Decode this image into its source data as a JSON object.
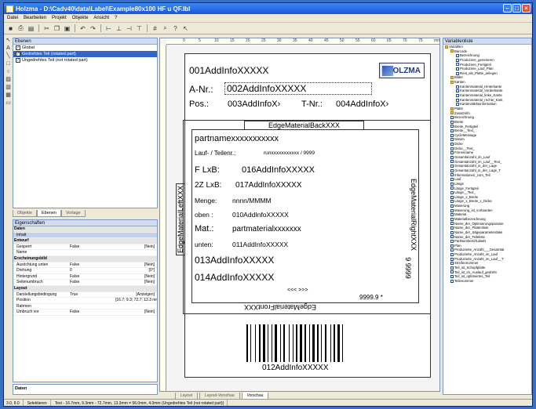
{
  "window": {
    "title": "Holzma - D:\\Cadv40\\data\\Label\\Example80x100 HF u QF.lbl"
  },
  "menu": [
    "Datei",
    "Bearbeiten",
    "Projekt",
    "Objekte",
    "Ansicht",
    "?"
  ],
  "layers_panel": {
    "header": "Ebenen",
    "items": [
      {
        "label": "Global",
        "checked": true
      },
      {
        "label": "Gedrehtes Teil (rotated part)",
        "checked": true,
        "selected": true
      },
      {
        "label": "Ungedrehtes Teil (not rotated part)",
        "checked": true
      }
    ]
  },
  "left_tabs": {
    "items": [
      "Objekte",
      "Ebenen",
      "Vorlage"
    ],
    "active": 1
  },
  "props_panel": {
    "header": "Eigenschaften",
    "rows": [
      {
        "type": "cat",
        "name": "Daten"
      },
      {
        "name": "Inhalt",
        "value": "",
        "unit": ""
      },
      {
        "type": "cat",
        "name": "Entwurf"
      },
      {
        "name": "Gesperrt",
        "value": "False",
        "unit": "[Nein]"
      },
      {
        "name": "Name",
        "value": "",
        "unit": ""
      },
      {
        "type": "cat",
        "name": "Erscheinungsbild"
      },
      {
        "name": "Ausrichtung unten",
        "value": "False",
        "unit": "[Nein]"
      },
      {
        "name": "Drehung",
        "value": "0",
        "unit": "[0°]"
      },
      {
        "name": "Hintergrund",
        "value": "False",
        "unit": "[Nein]"
      },
      {
        "name": "Seitenumbruch",
        "value": "False",
        "unit": "[Nein]"
      },
      {
        "type": "cat",
        "name": "Layout"
      },
      {
        "name": "Darstellungsbedingung",
        "value": "True",
        "unit": "[Anzeigen]"
      },
      {
        "name": "Position",
        "value": "",
        "unit": "[16.7; 9.3; 72.7; 13.3 mm]"
      },
      {
        "name": "Rahmen",
        "value": "",
        "unit": ""
      },
      {
        "name": "Umbruch vor",
        "value": "False",
        "unit": "[Nein]"
      }
    ],
    "footer": "Daten"
  },
  "label": {
    "row1": "001AddInfoXXXXX",
    "logo": "HOLZMA",
    "anr_label": "A-Nr.:",
    "anr_value": "002AddInfoXXXXX",
    "pos_label": "Pos.:",
    "pos_value": "003AddInfoX›",
    "tnr_label": "T-Nr.:",
    "tnr_value": "004AddInfoX›",
    "edge_top": "EdgeMaterialBackXXX",
    "edge_bottom": "EdgeMaterialFrontXXX",
    "edge_left": "EdgeMaterialLeftXXX",
    "edge_right": "EdgeMaterialRightXXX",
    "partname": "partnamexxxxxxxxxxx",
    "lauf_label": "Lauf- / Teilenr.:",
    "lauf_value": "runxxxxxxxxxxx / 9999",
    "flxb_label": "F LxB:",
    "flxb_value": "016AddInfoXXXXX",
    "zlxb_label": "2Z LxB:",
    "zlxb_value": "017AddInfoXXXXX",
    "menge_label": "Menge:",
    "menge_value": "nnnn/MMMM",
    "oben_label": "oben :",
    "oben_value": "010AddInfoXXXXX",
    "mat_label": "Mat.:",
    "mat_value": "partmaterialxxxxxxx",
    "unten_label": "unten:",
    "unten_value": "011AddInfoXXXXX",
    "r13": "013AddInfoXXXXX",
    "r14": "014AddInfoXXXXX",
    "rot_num": "9 9999",
    "arrows": "<<< >>>",
    "num9999": "9999.9 *",
    "barcode_text": "012AddInfoXXXXX"
  },
  "ruler_ticks": [
    "0",
    "5",
    "10",
    "15",
    "20",
    "25",
    "30",
    "35",
    "40",
    "45",
    "50",
    "55",
    "60",
    "65",
    "70",
    "75",
    "mm"
  ],
  "design_tabs": {
    "items": [
      "Layout",
      "Layout-Vorschau",
      "Vorschau"
    ],
    "active": 2
  },
  "vars_panel": {
    "header": "Variablenliste",
    "items": [
      {
        "label": "Variablen",
        "lvl": 0,
        "f": 1
      },
      {
        "label": "Barcode",
        "lvl": 1,
        "f": 1
      },
      {
        "label": "Bezeichnung",
        "lvl": 2
      },
      {
        "label": "Produziere_generieren",
        "lvl": 2
      },
      {
        "label": "Produziere_Fertigteil",
        "lvl": 2
      },
      {
        "label": "Produziere_Lauf_Plan",
        "lvl": 2
      },
      {
        "label": "Rest_als_Platte_anlegen",
        "lvl": 2
      },
      {
        "label": "Bilder",
        "lvl": 1,
        "f": 1
      },
      {
        "label": "Kanten",
        "lvl": 1,
        "f": 1
      },
      {
        "label": "Kantenmaterial_Hinterkante",
        "lvl": 2
      },
      {
        "label": "Kantenmaterial_Vorderkante",
        "lvl": 2
      },
      {
        "label": "Kantenmaterial_linke_Kante",
        "lvl": 2
      },
      {
        "label": "Kantenmaterial_rechte_Kant",
        "lvl": 2
      },
      {
        "label": "Kantenstärkeinformation",
        "lvl": 2
      },
      {
        "label": "Platte",
        "lvl": 1,
        "f": 1
      },
      {
        "label": "Zusatzinfo",
        "lvl": 1,
        "f": 1
      },
      {
        "label": "Bezeichnung",
        "lvl": 1
      },
      {
        "label": "Breite",
        "lvl": 1
      },
      {
        "label": "Breite_Fertigteil",
        "lvl": 1
      },
      {
        "label": "Breite__Text_",
        "lvl": 1
      },
      {
        "label": "CycleMessage",
        "lvl": 1
      },
      {
        "label": "Datum",
        "lvl": 1
      },
      {
        "label": "Dicke",
        "lvl": 1
      },
      {
        "label": "Dicke__Text_",
        "lvl": 1
      },
      {
        "label": "Firmenname",
        "lvl": 1
      },
      {
        "label": "Gesamtanzahl_im_Lauf",
        "lvl": 1
      },
      {
        "label": "Gesamtanzahl_im_Lauf__Text_",
        "lvl": 1
      },
      {
        "label": "Gesamtanzahl_in_der_Lage",
        "lvl": 1
      },
      {
        "label": "Gesamtanzahl_in_der_Lage_T",
        "lvl": 1
      },
      {
        "label": "Informationen_zum_Teil",
        "lvl": 1
      },
      {
        "label": "Lauf",
        "lvl": 1
      },
      {
        "label": "Länge",
        "lvl": 1
      },
      {
        "label": "Länge_Fertigteil",
        "lvl": 1
      },
      {
        "label": "Länge__Text_",
        "lvl": 1
      },
      {
        "label": "Länge_x_Breite",
        "lvl": 1
      },
      {
        "label": "Länge_x_Breite_x_Dicke",
        "lvl": 1
      },
      {
        "label": "Maserung",
        "lvl": 1
      },
      {
        "label": "Maserung_ist_vorhanden",
        "lvl": 1
      },
      {
        "label": "Material",
        "lvl": 1
      },
      {
        "label": "Materialbezeichnung",
        "lvl": 1
      },
      {
        "label": "Name_der_Optimierungsparame",
        "lvl": 1
      },
      {
        "label": "Name_der_Plattenliste",
        "lvl": 1
      },
      {
        "label": "Name_der_Sägeparameterdatei",
        "lvl": 1
      },
      {
        "label": "Name_der_Teileliste",
        "lvl": 1
      },
      {
        "label": "PartNumberOfLabels",
        "lvl": 1
      },
      {
        "label": "Plan",
        "lvl": 1
      },
      {
        "label": "Produzierte_Anzahl___Gesamtat",
        "lvl": 1
      },
      {
        "label": "Produzierte_Anzahl_im_Lauf",
        "lvl": 1
      },
      {
        "label": "Produzierte_Anzahl_im_Lauf__T",
        "lvl": 1
      },
      {
        "label": "Streifennummer",
        "lvl": 1
      },
      {
        "label": "Teil_ist_Schopfplatte",
        "lvl": 1
      },
      {
        "label": "Teil_ist_im_Auslauf_gedreht",
        "lvl": 1
      },
      {
        "label": "Teil_ist_optimiertes_Teil",
        "lvl": 1
      },
      {
        "label": "Teilenummer",
        "lvl": 1
      }
    ]
  },
  "status": [
    "3.0, 8.0",
    "Selektieren",
    "Text - 16.7mm, 9.3mm - 72.7mm, 13.3mm = 56.0mm, 4.0mm (Ungedrehtes Teil (not rotated part))"
  ]
}
